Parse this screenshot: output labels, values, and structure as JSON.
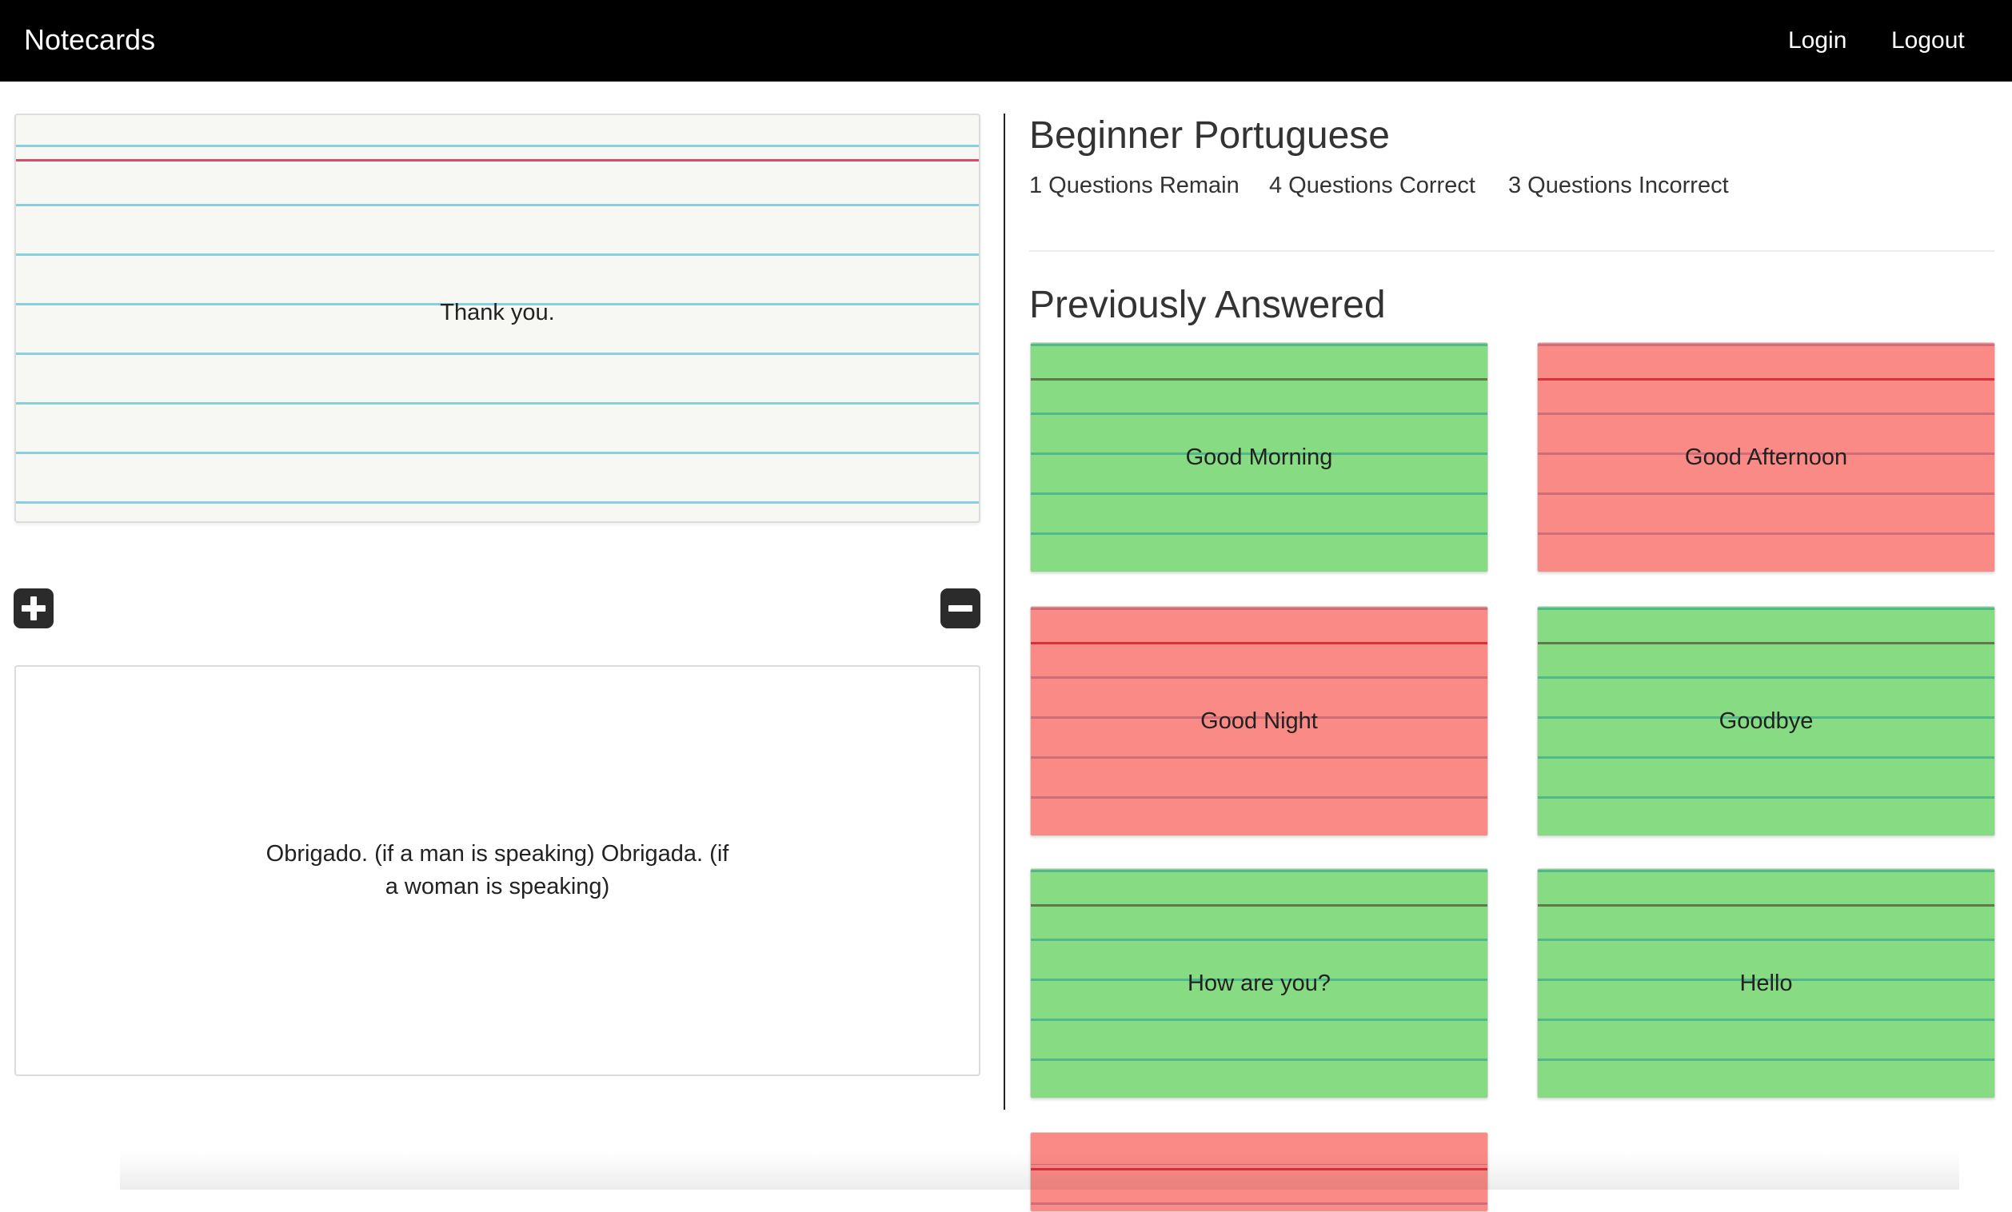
{
  "navbar": {
    "brand": "Notecards",
    "login": "Login",
    "logout": "Logout"
  },
  "study": {
    "question": "Thank you.",
    "answer": "Obrigado. (if a man is speaking) Obrigada. (if a woman is speaking)",
    "buttons": [
      "plus-icon",
      "minus-icon"
    ]
  },
  "deck": {
    "title": "Beginner Portuguese",
    "stats": {
      "remain": "1 Questions Remain",
      "correct": "4 Questions Correct",
      "incorrect": "3 Questions Incorrect"
    }
  },
  "previously_answered": {
    "heading": "Previously Answered",
    "cards": [
      {
        "label": "Good Morning",
        "result": "correct",
        "color": "#86db83"
      },
      {
        "label": "Good Afternoon",
        "result": "incorrect",
        "color": "#fa8a86"
      },
      {
        "label": "Good Night",
        "result": "incorrect",
        "color": "#fa8a86"
      },
      {
        "label": "Goodbye",
        "result": "correct",
        "color": "#86db83"
      },
      {
        "label": "How are you?",
        "result": "correct",
        "color": "#86db83"
      },
      {
        "label": "Hello",
        "result": "correct",
        "color": "#86db83"
      },
      {
        "label": "",
        "result": "incorrect",
        "color": "#fa8a86"
      }
    ]
  }
}
